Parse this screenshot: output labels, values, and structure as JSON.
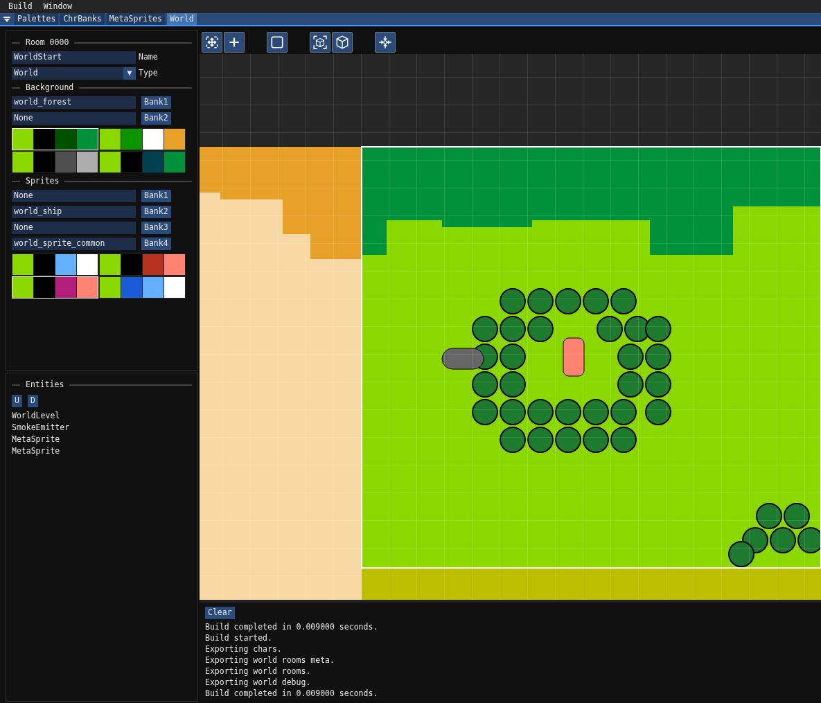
{
  "menu_bar": [
    "Build",
    "Window"
  ],
  "tabs": [
    {
      "label": "Palettes",
      "selected": false
    },
    {
      "label": "ChrBanks",
      "selected": false
    },
    {
      "label": "MetaSprites",
      "selected": false
    },
    {
      "label": "World",
      "selected": true
    }
  ],
  "room_panel": {
    "title": "Room 0000",
    "fields": [
      {
        "kind": "text",
        "value": "WorldStart",
        "label": "Name"
      },
      {
        "kind": "combo",
        "value": "World",
        "label": "Type",
        "arrow": "▼"
      }
    ],
    "background": {
      "title": "Background",
      "banks": [
        {
          "value": "world_forest",
          "button": "Bank1"
        },
        {
          "value": "None",
          "button": "Bank2"
        }
      ],
      "palettes": [
        {
          "selected": true,
          "swatches": [
            {
              "color": "#8bd800"
            },
            {
              "color": "#000000"
            },
            {
              "color": "#005000"
            },
            {
              "color": "#00913a"
            }
          ]
        },
        {
          "selected": false,
          "swatches": [
            {
              "color": "#8bd800"
            },
            {
              "color": "#0c9300"
            },
            {
              "color": "#ffffff"
            },
            {
              "color": "#e8a128"
            }
          ]
        },
        {
          "selected": false,
          "swatches": [
            {
              "color": "#8bd800"
            },
            {
              "color": "#000000"
            },
            {
              "color": "#4f4f4f"
            },
            {
              "color": "#adadad"
            }
          ]
        },
        {
          "selected": false,
          "swatches": [
            {
              "color": "#8bd800"
            },
            {
              "color": "#000000"
            },
            {
              "color": "#00404f"
            },
            {
              "color": "#00913a"
            }
          ]
        }
      ]
    },
    "sprites": {
      "title": "Sprites",
      "banks": [
        {
          "value": "None",
          "button": "Bank1"
        },
        {
          "value": "world_ship",
          "button": "Bank2"
        },
        {
          "value": "None",
          "button": "Bank3"
        },
        {
          "value": "world_sprite_common",
          "button": "Bank4"
        }
      ],
      "palettes": [
        {
          "selected": false,
          "swatches": [
            {
              "color": "#8bd800"
            },
            {
              "color": "#000000"
            },
            {
              "color": "#64b0ff"
            },
            {
              "color": "#ffffff"
            }
          ]
        },
        {
          "selected": false,
          "swatches": [
            {
              "color": "#8bd800"
            },
            {
              "color": "#000000"
            },
            {
              "color": "#b53120"
            },
            {
              "color": "#ff8370"
            }
          ]
        },
        {
          "selected": true,
          "swatches": [
            {
              "color": "#8bd800"
            },
            {
              "color": "#000000"
            },
            {
              "color": "#b41e7b"
            },
            {
              "color": "#ff8370"
            }
          ]
        },
        {
          "selected": false,
          "swatches": [
            {
              "color": "#8bd800"
            },
            {
              "color": "#1a5cd8"
            },
            {
              "color": "#64b0ff"
            },
            {
              "color": "#ffffff"
            }
          ]
        }
      ]
    }
  },
  "entities_panel": {
    "title": "Entities",
    "buttons": [
      "U",
      "D"
    ],
    "items": [
      "WorldLevel",
      "SmokeEmitter",
      "MetaSprite",
      "MetaSprite"
    ]
  },
  "toolbar": [
    {
      "kind": "move"
    },
    {
      "kind": "plus"
    },
    {
      "kind": "gap"
    },
    {
      "kind": "square"
    },
    {
      "kind": "gap"
    },
    {
      "kind": "cube-select"
    },
    {
      "kind": "cube"
    },
    {
      "kind": "gap"
    },
    {
      "kind": "center"
    }
  ],
  "console": {
    "button": "Clear",
    "lines": [
      "Build completed in 0.009000 seconds.",
      "Build started.",
      "Exporting chars.",
      "Exporting world rooms meta.",
      "Exporting world rooms.",
      "Exporting world debug.",
      "Build completed in 0.009000 seconds."
    ]
  }
}
